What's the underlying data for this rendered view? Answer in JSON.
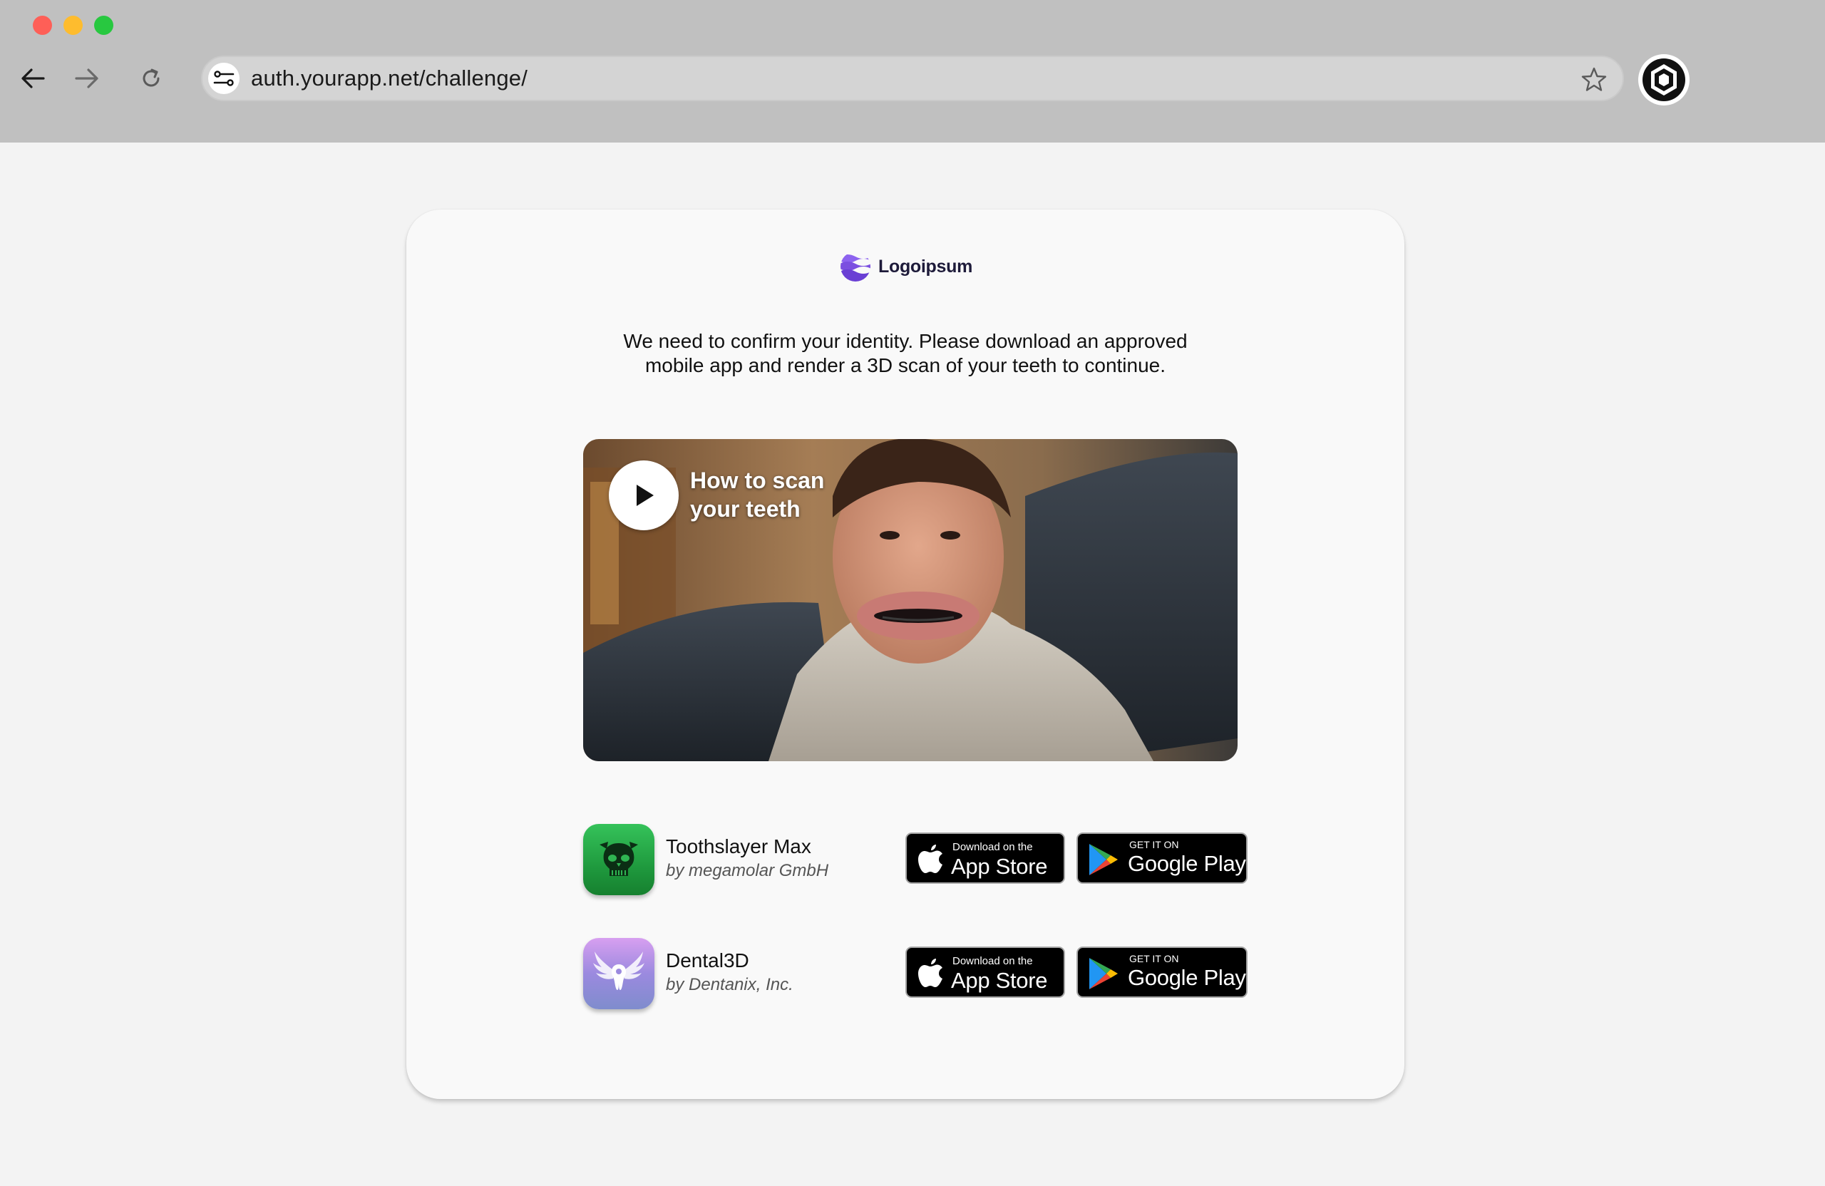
{
  "browser": {
    "url": "auth.yourapp.net/challenge/"
  },
  "brand": {
    "name": "Logoipsum",
    "accent": "#7b4fe0"
  },
  "message": {
    "line1": "We need to confirm your identity. Please download an approved",
    "line2": "mobile app and render a 3D scan of your teeth to continue."
  },
  "video": {
    "title_line1": "How to scan",
    "title_line2": "your teeth"
  },
  "apps": [
    {
      "name": "Toothslayer Max",
      "developer": "by megamolar GmbH",
      "icon": "skull-icon"
    },
    {
      "name": "Dental3D",
      "developer": "by Dentanix, Inc.",
      "icon": "winged-tooth-icon"
    }
  ],
  "badges": {
    "apple_small": "Download on the",
    "apple_big": "App Store",
    "google_small": "GET IT ON",
    "google_big": "Google Play"
  }
}
